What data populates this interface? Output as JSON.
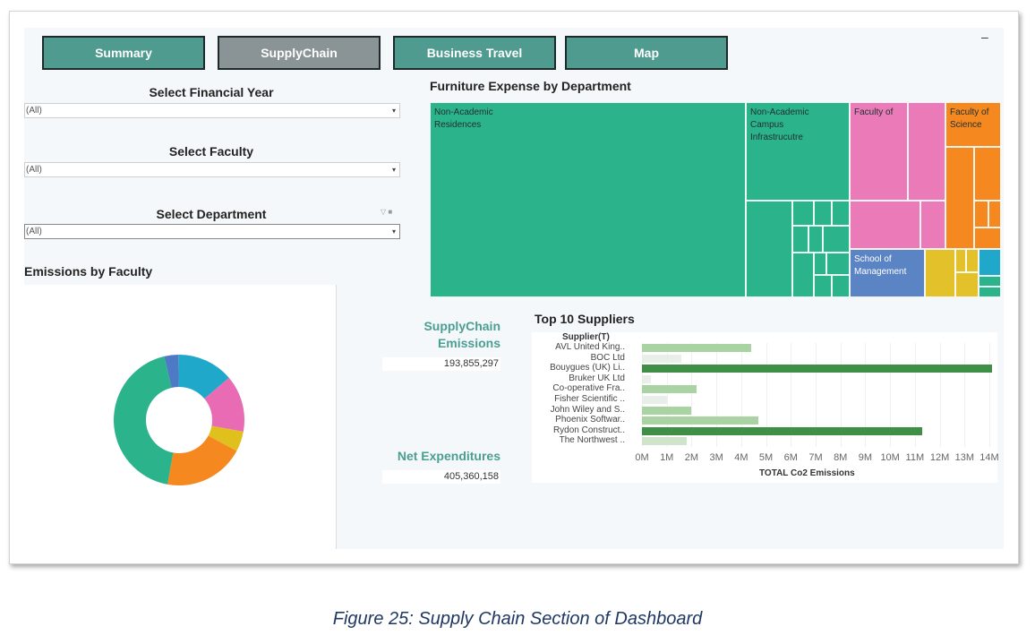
{
  "nav": {
    "buttons": [
      {
        "label": "Summary",
        "color": "#4f9b8f"
      },
      {
        "label": "SupplyChain",
        "color": "#8a9396"
      },
      {
        "label": "Business Travel",
        "color": "#4f9b8f"
      },
      {
        "label": "Map",
        "color": "#4f9b8f"
      }
    ],
    "minimize_label": "–"
  },
  "filters": {
    "year": {
      "title": "Select Financial Year",
      "value": "(All)"
    },
    "faculty": {
      "title": "Select Faculty",
      "value": "(All)"
    },
    "department": {
      "title": "Select Department",
      "value": "(All)"
    },
    "dropdown_arrow": "▾",
    "filter_icons": "▽ ■"
  },
  "emissions_by_faculty": {
    "title": "Emissions by Faculty",
    "slices": [
      {
        "value": 3.5,
        "color": "#4e79c5"
      },
      {
        "value": 14,
        "color": "#1fa8c9"
      },
      {
        "value": 14,
        "color": "#e86bb4"
      },
      {
        "value": 5,
        "color": "#e0c01c"
      },
      {
        "value": 20,
        "color": "#f5881f"
      },
      {
        "value": 43.5,
        "color": "#2bb38b"
      }
    ]
  },
  "treemap": {
    "title": "Furniture Expense by Department",
    "labels": {
      "residences": "Non-Academic\nResidences",
      "campus": "Non-Academic\nCampus\nInfrastrucutre",
      "faculty_of": "Faculty of",
      "science": "Faculty of\nScience",
      "management": "School of\nManagement"
    },
    "colors": {
      "green": "#2bb38b",
      "pink": "#ea7ab8",
      "orange": "#f5881f",
      "blue": "#5b84c4",
      "yellow": "#e2c12b",
      "cyan": "#1fa8c9"
    }
  },
  "kpis": {
    "supply": {
      "title_line1": "SupplyChain",
      "title_line2": "Emissions",
      "value": "193,855,297"
    },
    "expenditure": {
      "title": "Net Expenditures",
      "value": "405,360,158"
    }
  },
  "top_suppliers": {
    "title": "Top 10 Suppliers",
    "header": "Supplier(T)",
    "xlabel": "TOTAL Co2 Emissions"
  },
  "chart_data": {
    "type": "bar",
    "orientation": "horizontal",
    "categories": [
      "AVL United King..",
      "BOC Ltd",
      "Bouygues (UK) Li..",
      "Bruker UK Ltd",
      "Co-operative Fra..",
      "Fisher Scientific ..",
      "John Wiley and S..",
      "Phoenix Softwar..",
      "Rydon Construct..",
      "The Northwest .."
    ],
    "values": [
      4.4,
      1.6,
      14.1,
      0.35,
      2.2,
      1.0,
      2.0,
      4.7,
      11.3,
      1.8
    ],
    "bar_colors": [
      "#a9d3a3",
      "#e8eee8",
      "#3f8f46",
      "#e8eee8",
      "#a9d3a3",
      "#e8eee8",
      "#a9d3a3",
      "#a9d3a3",
      "#3f8f46",
      "#cfe4cb"
    ],
    "ticks": [
      "0M",
      "1M",
      "2M",
      "3M",
      "4M",
      "5M",
      "6M",
      "7M",
      "8M",
      "9M",
      "10M",
      "11M",
      "12M",
      "13M",
      "14M"
    ],
    "xlim": [
      0,
      14
    ],
    "unit": "M",
    "title": "Top 10 Suppliers",
    "xlabel": "TOTAL Co2 Emissions",
    "ylabel": "Supplier(T)"
  },
  "caption": "Figure 25: Supply Chain Section of Dashboard"
}
